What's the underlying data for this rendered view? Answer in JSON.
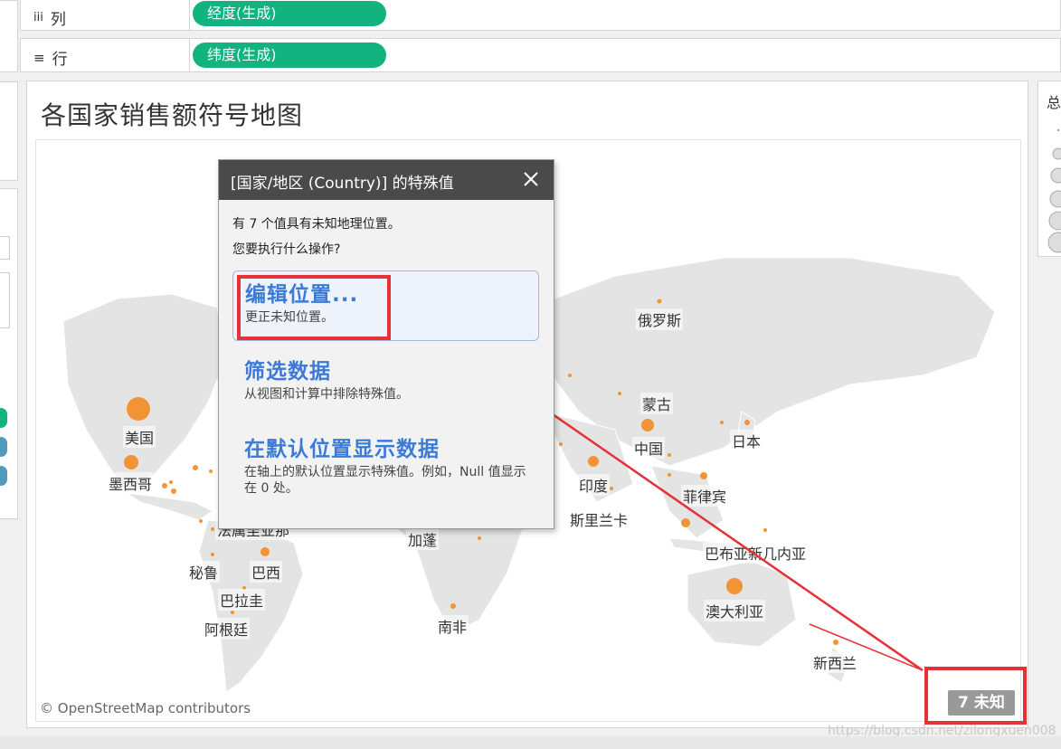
{
  "shelves": {
    "columns": {
      "label": "列",
      "pill": "经度(生成)"
    },
    "rows": {
      "label": "行",
      "pill": "纬度(生成)"
    }
  },
  "sheet": {
    "title": "各国家销售额符号地图"
  },
  "legend": {
    "title": "总"
  },
  "map": {
    "attribution": "© OpenStreetMap contributors",
    "labels": [
      "美国",
      "墨西哥",
      "秘鲁",
      "巴西",
      "巴拉圭",
      "阿根廷",
      "加蓬",
      "南非",
      "印度",
      "斯里兰卡",
      "中国",
      "蒙古",
      "俄罗斯",
      "日本",
      "菲律宾",
      "巴布亚新几内亚",
      "澳大利亚",
      "新西兰",
      "法属圭亚那"
    ],
    "unknown_count_label": "7 未知",
    "marker_color": "#f28e2b"
  },
  "dialog": {
    "title": "[国家/地区 (Country)] 的特殊值",
    "message_line1": "有 7 个值具有未知地理位置。",
    "message_line2": "您要执行什么操作?",
    "options": [
      {
        "title": "编辑位置...",
        "desc": "更正未知位置。"
      },
      {
        "title": "筛选数据",
        "desc": "从视图和计算中排除特殊值。"
      },
      {
        "title": "在默认位置显示数据",
        "desc": "在轴上的默认位置显示特殊值。例如，Null 值显示在 0 处。"
      }
    ]
  },
  "watermark": "https://blog.csdn.net/zilongxuen008",
  "colors": {
    "pill": "#13b37f",
    "dialog_header": "#4a4a4a",
    "highlight": "#e53238",
    "link": "#3c7ad8"
  }
}
